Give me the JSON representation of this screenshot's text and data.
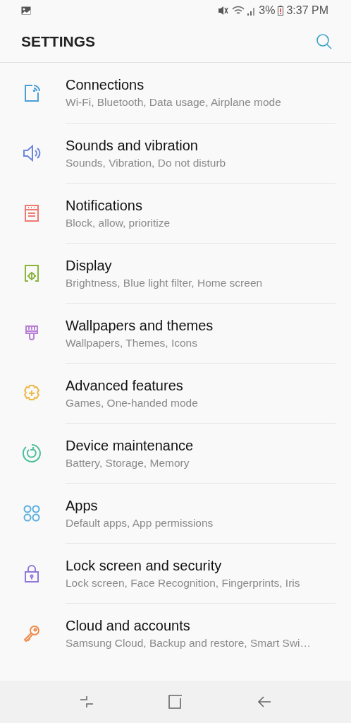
{
  "status_bar": {
    "battery": "3%",
    "time": "3:37 PM"
  },
  "header": {
    "title": "SETTINGS"
  },
  "items": [
    {
      "kind": "connections",
      "color": "#4a9fd8",
      "title": "Connections",
      "subtitle": "Wi-Fi, Bluetooth, Data usage, Airplane mode"
    },
    {
      "kind": "sounds",
      "color": "#6a86e0",
      "title": "Sounds and vibration",
      "subtitle": "Sounds, Vibration, Do not disturb"
    },
    {
      "kind": "notifications",
      "color": "#ef7a72",
      "title": "Notifications",
      "subtitle": "Block, allow, prioritize"
    },
    {
      "kind": "display",
      "color": "#8bb43c",
      "title": "Display",
      "subtitle": "Brightness, Blue light filter, Home screen"
    },
    {
      "kind": "wallpapers",
      "color": "#b77fd6",
      "title": "Wallpapers and themes",
      "subtitle": "Wallpapers, Themes, Icons"
    },
    {
      "kind": "advanced",
      "color": "#edb949",
      "title": "Advanced features",
      "subtitle": "Games, One-handed mode"
    },
    {
      "kind": "maintenance",
      "color": "#4fbf9c",
      "title": "Device maintenance",
      "subtitle": "Battery, Storage, Memory"
    },
    {
      "kind": "apps",
      "color": "#5aaee0",
      "title": "Apps",
      "subtitle": "Default apps, App permissions"
    },
    {
      "kind": "lock",
      "color": "#8f78dc",
      "title": "Lock screen and security",
      "subtitle": "Lock screen, Face Recognition, Fingerprints, Iris"
    },
    {
      "kind": "cloud",
      "color": "#f08a4b",
      "title": "Cloud and accounts",
      "subtitle": "Samsung Cloud, Backup and restore, Smart Swi…"
    }
  ]
}
